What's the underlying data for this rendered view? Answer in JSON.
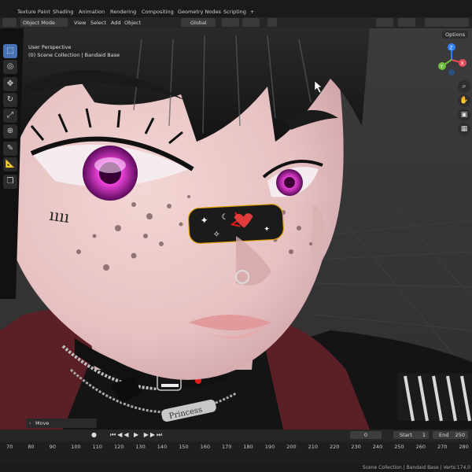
{
  "workspace_tabs": [
    "Texture Paint",
    "Shading",
    "Animation",
    "Rendering",
    "Compositing",
    "Geometry Nodes",
    "Scripting",
    "+"
  ],
  "header": {
    "mode": "Object Mode",
    "menus": [
      "View",
      "Select",
      "Add",
      "Object"
    ],
    "orientation": "Global",
    "options": "Options"
  },
  "viewport": {
    "perspective": "User Perspective",
    "collection": "(0) Scene Collection | Bandaid Base",
    "tattoo_text": "ıııı",
    "choker_text": "Princess"
  },
  "gizmo": {
    "x": "X",
    "y": "Y",
    "z": "Z"
  },
  "operator_panel": {
    "label": "Move"
  },
  "timeline": {
    "current_frame": "0",
    "start_label": "Start",
    "start": "1",
    "end_label": "End",
    "end": "250",
    "ticks": [
      "70",
      "80",
      "90",
      "100",
      "110",
      "120",
      "130",
      "140",
      "150",
      "160",
      "170",
      "180",
      "190",
      "200",
      "210",
      "220",
      "230",
      "240",
      "250",
      "260",
      "270",
      "280"
    ]
  },
  "status": {
    "text": "Scene Collection | Bandaid Base | Verts:174,0"
  },
  "colors": {
    "accent": "#4772b3",
    "active_tab": "#2b2b2b",
    "eye": "#ff3ce0"
  }
}
